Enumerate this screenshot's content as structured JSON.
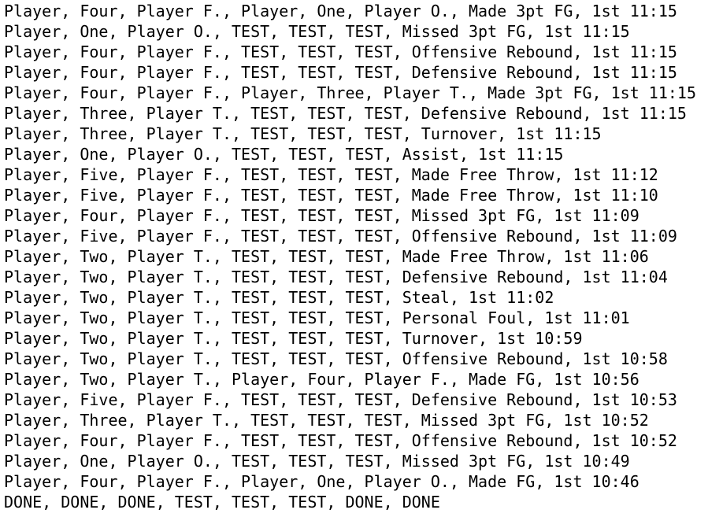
{
  "console": {
    "lines": [
      "Player, Four, Player F., Player, One, Player O., Made 3pt FG, 1st 11:15",
      "Player, One, Player O., TEST, TEST, TEST, Missed 3pt FG, 1st 11:15",
      "Player, Four, Player F., TEST, TEST, TEST, Offensive Rebound, 1st 11:15",
      "Player, Four, Player F., TEST, TEST, TEST, Defensive Rebound, 1st 11:15",
      "Player, Four, Player F., Player, Three, Player T., Made 3pt FG, 1st 11:15",
      "Player, Three, Player T., TEST, TEST, TEST, Defensive Rebound, 1st 11:15",
      "Player, Three, Player T., TEST, TEST, TEST, Turnover, 1st 11:15",
      "Player, One, Player O., TEST, TEST, TEST, Assist, 1st 11:15",
      "Player, Five, Player F., TEST, TEST, TEST, Made Free Throw, 1st 11:12",
      "Player, Five, Player F., TEST, TEST, TEST, Made Free Throw, 1st 11:10",
      "Player, Four, Player F., TEST, TEST, TEST, Missed 3pt FG, 1st 11:09",
      "Player, Five, Player F., TEST, TEST, TEST, Offensive Rebound, 1st 11:09",
      "Player, Two, Player T., TEST, TEST, TEST, Made Free Throw, 1st 11:06",
      "Player, Two, Player T., TEST, TEST, TEST, Defensive Rebound, 1st 11:04",
      "Player, Two, Player T., TEST, TEST, TEST, Steal, 1st 11:02",
      "Player, Two, Player T., TEST, TEST, TEST, Personal Foul, 1st 11:01",
      "Player, Two, Player T., TEST, TEST, TEST, Turnover, 1st 10:59",
      "Player, Two, Player T., TEST, TEST, TEST, Offensive Rebound, 1st 10:58",
      "Player, Two, Player T., Player, Four, Player F., Made FG, 1st 10:56",
      "Player, Five, Player F., TEST, TEST, TEST, Defensive Rebound, 1st 10:53",
      "Player, Three, Player T., TEST, TEST, TEST, Missed 3pt FG, 1st 10:52",
      "Player, Four, Player F., TEST, TEST, TEST, Offensive Rebound, 1st 10:52",
      "Player, One, Player O., TEST, TEST, TEST, Missed 3pt FG, 1st 10:49",
      "Player, Four, Player F., Player, One, Player O., Made FG, 1st 10:46",
      "DONE, DONE, DONE, TEST, TEST, TEST, DONE, DONE"
    ]
  }
}
